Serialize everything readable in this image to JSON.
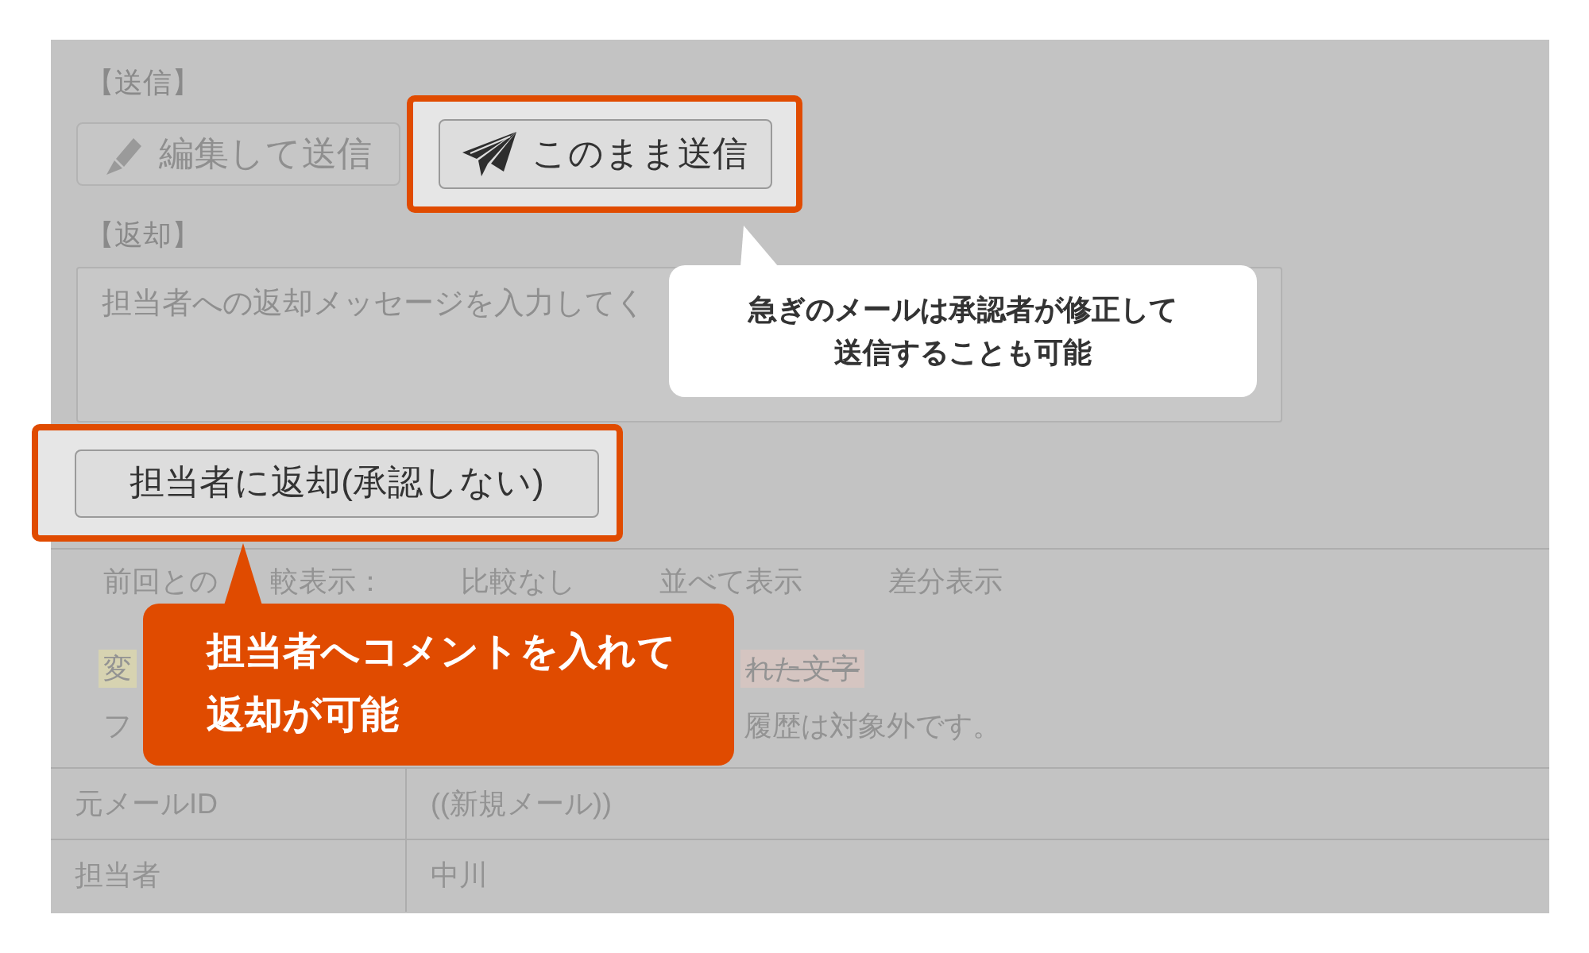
{
  "send_section": {
    "heading": "【送信】",
    "buttons": [
      {
        "kind": "edit",
        "label": "編集して送信",
        "highlighted": false
      },
      {
        "kind": "send",
        "label": "このまま送信",
        "highlighted": true
      }
    ],
    "callout": {
      "kind": "light",
      "lines": [
        "急ぎのメールは承認者が修正して",
        "送信することも可能"
      ]
    }
  },
  "return_section": {
    "heading": "【返却】",
    "message_field": {
      "placeholder": "担当者への返却メッセージを入力してく"
    },
    "button": {
      "label": "担当者に返却(承認しない)",
      "highlighted": true
    },
    "callout": {
      "kind": "accent",
      "lines": [
        "担当者へコメントを入れて",
        "返却が可能"
      ]
    }
  },
  "comparison": {
    "label_parts": [
      "前回との",
      "較表示："
    ],
    "options": [
      "比較なし",
      "並べて表示",
      "差分表示"
    ]
  },
  "legend": [
    {
      "kind": "changed",
      "text": "変"
    },
    {
      "kind": "deleted",
      "text": "れた文字"
    }
  ],
  "note_parts": [
    "フ",
    "履歴は対象外です。"
  ],
  "table": {
    "rows": [
      {
        "label": "元メールID",
        "value": "((新規メール))"
      },
      {
        "label": "担当者",
        "value": "中川"
      }
    ]
  }
}
